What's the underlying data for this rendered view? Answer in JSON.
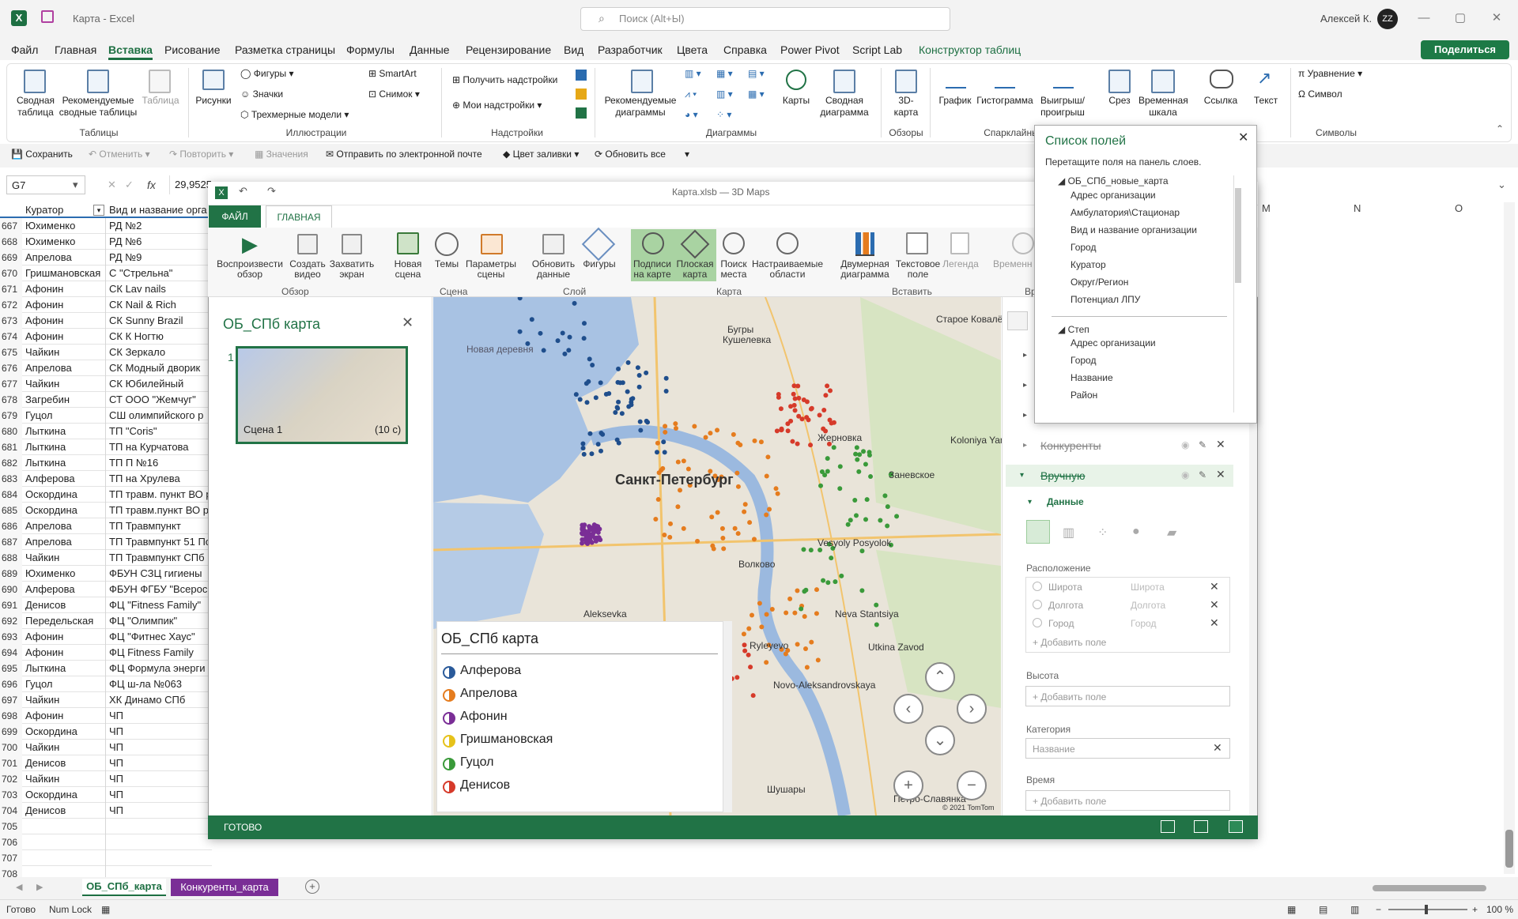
{
  "titlebar": {
    "app_title": "Карта - Excel",
    "search_placeholder": "Поиск (Alt+Ы)",
    "user": "Алексей К.",
    "avatar": "ZZ",
    "share": "Поделиться"
  },
  "menu": [
    "Файл",
    "Главная",
    "Вставка",
    "Рисование",
    "Разметка страницы",
    "Формулы",
    "Данные",
    "Рецензирование",
    "Вид",
    "Разработчик",
    "Цвета",
    "Справка",
    "Power Pivot",
    "Script Lab",
    "Конструктор таблиц"
  ],
  "ribbon": {
    "pivot": "Сводная таблица",
    "recpivot": "Рекомендуемые сводные таблицы",
    "table": "Таблица",
    "g_tables": "Таблицы",
    "pictures": "Рисунки",
    "shapes": "Фигуры",
    "icons": "Значки",
    "models3d": "Трехмерные модели",
    "smartart": "SmartArt",
    "snapshot": "Снимок",
    "g_illus": "Иллюстрации",
    "getaddins": "Получить надстройки",
    "myaddins": "Мои надстройки",
    "g_addins": "Надстройки",
    "recchart": "Рекомендуемые диаграммы",
    "maps": "Карты",
    "pivotchart": "Сводная диаграмма",
    "g_charts": "Диаграммы",
    "map3d": "3D-карта",
    "g_tours": "Обзоры",
    "line": "График",
    "column": "Гистограмма",
    "winloss": "Выигрыш/ проигрыш",
    "g_spark": "Спарклайны",
    "slicer": "Срез",
    "timeline": "Временная шкала",
    "link": "Ссылка",
    "text": "Текст",
    "equation": "Уравнение",
    "symbol": "Символ",
    "g_symbols": "Символы"
  },
  "qat": {
    "save": "Сохранить",
    "undo": "Отменить",
    "redo": "Повторить",
    "values": "Значения",
    "email": "Отправить по электронной почте",
    "fill": "Цвет заливки",
    "refresh": "Обновить все"
  },
  "formula": {
    "cell": "G7",
    "value": "29,9525"
  },
  "sheet": {
    "headers": [
      "Куратор",
      "Вид и название орга"
    ],
    "colrefs": [
      "M",
      "N",
      "O"
    ],
    "rows": [
      [
        "667",
        "Юхименко",
        "РД №2"
      ],
      [
        "668",
        "Юхименко",
        "РД №6"
      ],
      [
        "669",
        "Апрелова",
        "РД №9"
      ],
      [
        "670",
        "Гришмановская",
        "С \"Стрельна\""
      ],
      [
        "671",
        "Афонин",
        "СК  Lav nails"
      ],
      [
        "672",
        "Афонин",
        "СК  Nail & Rich"
      ],
      [
        "673",
        "Афонин",
        "СК  Sunny Brazil"
      ],
      [
        "674",
        "Афонин",
        "СК  К Ногтю"
      ],
      [
        "675",
        "Чайкин",
        "СК Зеркало"
      ],
      [
        "676",
        "Апрелова",
        "СК Модный дворик"
      ],
      [
        "677",
        "Чайкин",
        "СК Юбилейный"
      ],
      [
        "678",
        "Загребин",
        "СТ ООО \"Жемчуг\""
      ],
      [
        "679",
        "Гуцол",
        "СШ олимпийского р"
      ],
      [
        "680",
        "Лыткина",
        "ТП  \"Coris\""
      ],
      [
        "681",
        "Лыткина",
        "ТП  на Курчатова"
      ],
      [
        "682",
        "Лыткина",
        "ТП  П №16"
      ],
      [
        "683",
        "Алферова",
        "ТП на Хрулева"
      ],
      [
        "684",
        "Оскордина",
        "ТП травм. пункт ВО р"
      ],
      [
        "685",
        "Оскордина",
        "ТП травм.пункт ВО р"
      ],
      [
        "686",
        "Апрелова",
        "ТП Травмпункт"
      ],
      [
        "687",
        "Апрелова",
        "ТП Травмпункт 51 По"
      ],
      [
        "688",
        "Чайкин",
        "ТП Травмпункт СПб"
      ],
      [
        "689",
        "Юхименко",
        "ФБУН СЗЦ гигиены"
      ],
      [
        "690",
        "Алферова",
        "ФБУН ФГБУ \"Всеросс"
      ],
      [
        "691",
        "Денисов",
        "ФЦ \"Fitness Family\""
      ],
      [
        "692",
        "Передельская",
        "ФЦ \"Олимпик\""
      ],
      [
        "693",
        "Афонин",
        "ФЦ \"Фитнес Хаус\""
      ],
      [
        "694",
        "Афонин",
        "ФЦ Fitness Family"
      ],
      [
        "695",
        "Лыткина",
        "ФЦ Формула энерги"
      ],
      [
        "696",
        "Гуцол",
        "ФЦ ш-ла №063"
      ],
      [
        "697",
        "Чайкин",
        "ХК Динамо СПб"
      ],
      [
        "698",
        "Афонин",
        "ЧП"
      ],
      [
        "699",
        "Оскордина",
        "ЧП"
      ],
      [
        "700",
        "Чайкин",
        "ЧП"
      ],
      [
        "701",
        "Денисов",
        "ЧП"
      ],
      [
        "702",
        "Чайкин",
        "ЧП"
      ],
      [
        "703",
        "Оскордина",
        "ЧП"
      ],
      [
        "704",
        "Денисов",
        "ЧП"
      ],
      [
        "705",
        "",
        ""
      ],
      [
        "706",
        "",
        ""
      ],
      [
        "707",
        "",
        ""
      ],
      [
        "708",
        "",
        ""
      ]
    ]
  },
  "sheettabs": [
    "ОБ_СПб_карта",
    "Конкуренты_карта"
  ],
  "status": {
    "ready": "Готово",
    "numlock": "Num Lock",
    "zoom": "100 %"
  },
  "maps": {
    "title": "Карта.xlsb — 3D Maps",
    "file": "ФАЙЛ",
    "home": "ГЛАВНАЯ",
    "buttons": [
      "Воспроизвести обзор",
      "Создать видео",
      "Захватить экран",
      "Новая сцена",
      "Темы",
      "Параметры сцены",
      "Обновить данные",
      "Фигуры",
      "Подписи на карте",
      "Плоская карта",
      "Поиск места",
      "Настраиваемые области",
      "Двумерная диаграмма",
      "Текстовое поле",
      "Легенда",
      "Временная шкала"
    ],
    "groups": [
      "Обзор",
      "Сцена",
      "Слой",
      "Карта",
      "Вставить",
      "Вр"
    ],
    "tour_title": "ОБ_СПб карта",
    "scene_num": "1",
    "scene_name": "Сцена 1",
    "scene_time": "(10 с)",
    "legend_title": "ОБ_СПб карта",
    "legend": [
      [
        "Алферова",
        "#2a5a9a"
      ],
      [
        "Апрелова",
        "#e57c1e"
      ],
      [
        "Афонин",
        "#7a2e96"
      ],
      [
        "Гришмановская",
        "#e6c21a"
      ],
      [
        "Гуцол",
        "#3a9a3a"
      ],
      [
        "Денисов",
        "#d63a2a"
      ]
    ],
    "places": [
      "Санкт-Петербург",
      "Старое Ковалёво",
      "Бугры",
      "Кушелевка",
      "Жерновка",
      "Koloniya Yanino",
      "Заневское",
      "Новая деревня",
      "Волково",
      "Vesyoly Posyolok",
      "Aleksevka",
      "Nevа Stantsiya",
      "Ryleyevo",
      "Utkina Zavod",
      "Novo-Aleksandrovskaya",
      "Шушары",
      "Петро-Славянка",
      "© 2021 TomTom"
    ],
    "layers": [
      "Конкуренты",
      "Вручную"
    ],
    "data": "Данные",
    "location": "Расположение",
    "loc_fields": [
      [
        "Широта",
        "Широта"
      ],
      [
        "Долгота",
        "Долгота"
      ],
      [
        "Город",
        "Город"
      ]
    ],
    "addfield": "Добавить поле",
    "height": "Высота",
    "category": "Категория",
    "category_value": "Название",
    "time": "Время",
    "status": "ГОТОВО"
  },
  "fieldlist": {
    "title": "Список полей",
    "hint": "Перетащите поля на панель слоев.",
    "table1": "ОБ_СПб_новые_карта",
    "fields1": [
      "Адрес организации",
      "Амбулатория\\Стационар",
      "Вид и название организации",
      "Город",
      "Куратор",
      "Округ/Регион",
      "Потенциал ЛПУ"
    ],
    "table2": "Степ",
    "fields2": [
      "Адрес организации",
      "Город",
      "Название",
      "Район"
    ]
  }
}
